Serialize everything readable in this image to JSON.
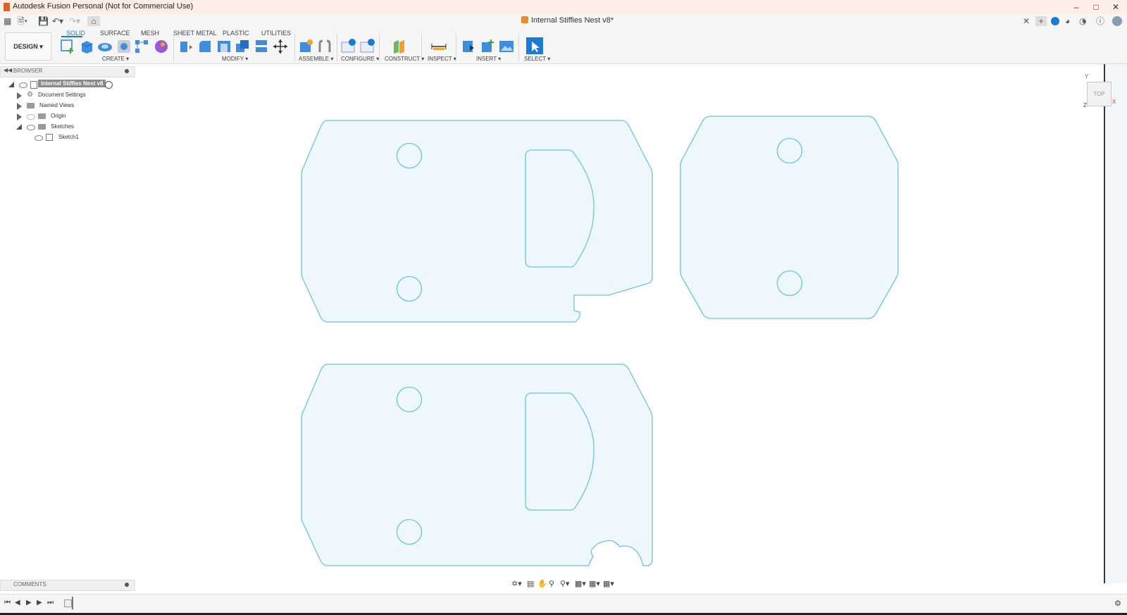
{
  "window": {
    "title": "Autodesk Fusion Personal (Not for Commercial Use)",
    "controls": [
      "minimize",
      "maximize",
      "close"
    ]
  },
  "document_tab": {
    "name": "Internal Stiffies Nest v8*"
  },
  "toolbar": {
    "workspace": "DESIGN",
    "tabs": [
      "SOLID",
      "SURFACE",
      "MESH",
      "SHEET METAL",
      "PLASTIC",
      "UTILITIES"
    ],
    "active_tab": "SOLID",
    "groups": [
      "CREATE",
      "MODIFY",
      "ASSEMBLE",
      "CONFIGURE",
      "CONSTRUCT",
      "INSPECT",
      "INSERT",
      "SELECT"
    ]
  },
  "browser": {
    "label": "BROWSER",
    "root": "Internal Stiffies Nest v8",
    "items": [
      {
        "label": "Document Settings"
      },
      {
        "label": "Named Views"
      },
      {
        "label": "Origin"
      },
      {
        "label": "Sketches"
      },
      {
        "label": "Sketch1"
      }
    ]
  },
  "viewcube": {
    "face": "TOP",
    "axes": [
      "Y",
      "Z",
      "X"
    ]
  },
  "comments": {
    "label": "COMMENTS"
  },
  "colors": {
    "accent": "#1a7bd1",
    "sketch_stroke": "#6ec3e3",
    "sketch_fill": "#eef7fb",
    "title_bg": "#fdefe6"
  }
}
